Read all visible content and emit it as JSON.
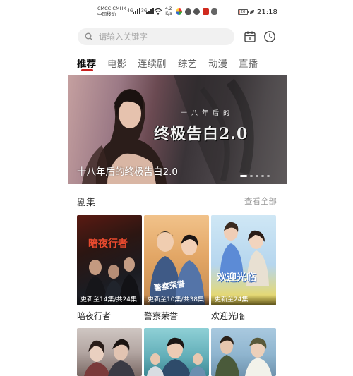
{
  "status": {
    "carrier_line1": "CMCC|CMHK",
    "carrier_line2": "中国移动",
    "net1": "4G",
    "net2": "3G",
    "speed_value": "4.2",
    "speed_unit": "K/s",
    "battery": "20",
    "time": "21:18"
  },
  "search": {
    "placeholder": "请输入关键字"
  },
  "tabs": [
    {
      "label": "推荐",
      "active": true
    },
    {
      "label": "电影"
    },
    {
      "label": "连续剧"
    },
    {
      "label": "综艺"
    },
    {
      "label": "动漫"
    },
    {
      "label": "直播"
    }
  ],
  "banner": {
    "title": "十八年后的终极告白2.0",
    "logo_sub": "十八年后的",
    "logo_main": "终极告白2.0",
    "page_count": 5,
    "active_index": 0
  },
  "section": {
    "title": "剧集",
    "more": "查看全部",
    "items": [
      {
        "title": "暗夜行者",
        "episodes": "更新至14集/共24集",
        "poster_text": "暗夜行者"
      },
      {
        "title": "警察荣誉",
        "episodes": "更新至10集/共38集",
        "poster_text": "警察荣誉"
      },
      {
        "title": "欢迎光临",
        "episodes": "更新至24集",
        "poster_text": "欢迎光临"
      }
    ]
  },
  "colors": {
    "accent": "#c8201f",
    "muted": "#999999"
  }
}
